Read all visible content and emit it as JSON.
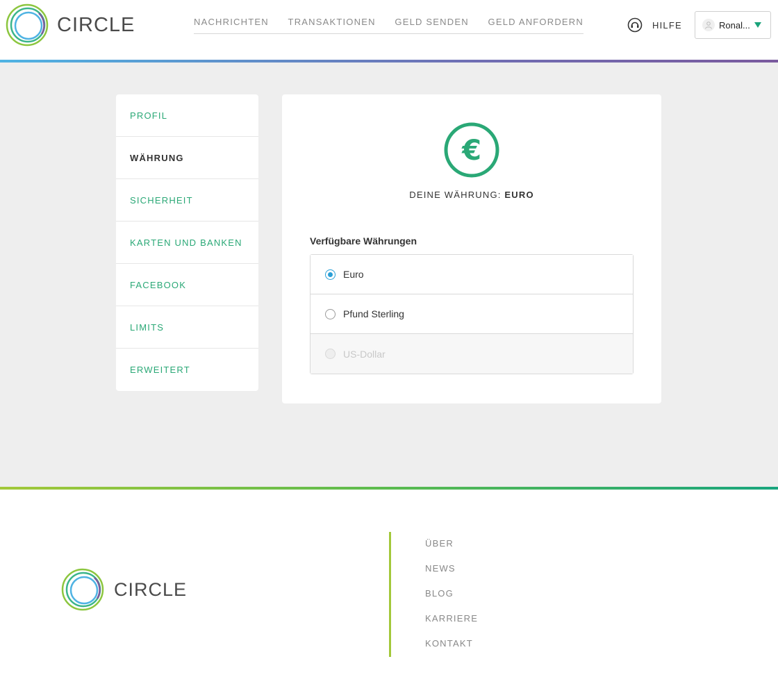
{
  "brand": {
    "name": "CIRCLE"
  },
  "topnav": {
    "items": [
      "NACHRICHTEN",
      "TRANSAKTIONEN",
      "GELD SENDEN",
      "GELD ANFORDERN"
    ]
  },
  "header": {
    "help_label": "HILFE",
    "user_name": "Ronal..."
  },
  "sidebar": {
    "items": [
      {
        "label": "PROFIL"
      },
      {
        "label": "WÄHRUNG",
        "active": true
      },
      {
        "label": "SICHERHEIT"
      },
      {
        "label": "KARTEN UND BANKEN"
      },
      {
        "label": "FACEBOOK"
      },
      {
        "label": "LIMITS"
      },
      {
        "label": "ERWEITERT"
      }
    ]
  },
  "currency": {
    "label": "DEINE WÄHRUNG: ",
    "value": "EURO",
    "symbol": "€",
    "available_label": "Verfügbare Währungen",
    "options": [
      {
        "label": "Euro",
        "selected": true,
        "disabled": false
      },
      {
        "label": "Pfund Sterling",
        "selected": false,
        "disabled": false
      },
      {
        "label": "US-Dollar",
        "selected": false,
        "disabled": true
      }
    ]
  },
  "footer": {
    "links": [
      "ÜBER",
      "NEWS",
      "BLOG",
      "KARRIERE",
      "KONTAKT"
    ]
  },
  "colors": {
    "accent_green": "#2aa876",
    "radio_blue": "#2a9fd6",
    "footer_bar": "#a3c83a"
  }
}
